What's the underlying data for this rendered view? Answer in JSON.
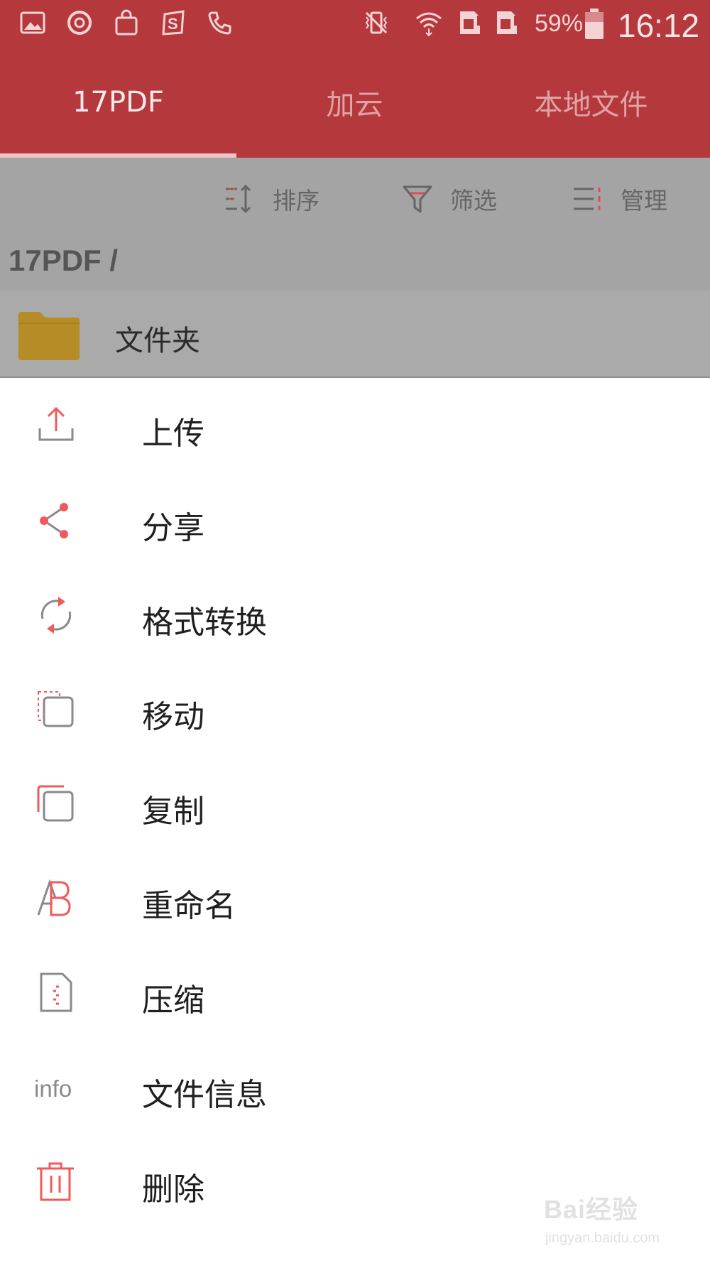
{
  "status_bar": {
    "battery_percent": "59%",
    "time": "16:12",
    "left_icons": [
      "gallery-icon",
      "sync-icon",
      "shopping-bag-icon",
      "s-app-icon",
      "phone-call-icon"
    ],
    "right_icons": [
      "vibrate-icon",
      "wifi-icon",
      "sim1-icon",
      "sim2-icon",
      "battery-icon"
    ]
  },
  "tabs": [
    {
      "label": "17PDF",
      "active": true
    },
    {
      "label": "加云",
      "active": false
    },
    {
      "label": "本地文件",
      "active": false
    }
  ],
  "toolbar": {
    "sort_label": "排序",
    "filter_label": "筛选",
    "manage_label": "管理"
  },
  "breadcrumb": "17PDF /",
  "folder": {
    "name": "文件夹"
  },
  "menu": {
    "items": [
      {
        "label": "上传",
        "icon": "upload-icon"
      },
      {
        "label": "分享",
        "icon": "share-icon"
      },
      {
        "label": "格式转换",
        "icon": "convert-icon"
      },
      {
        "label": "移动",
        "icon": "move-icon"
      },
      {
        "label": "复制",
        "icon": "copy-icon"
      },
      {
        "label": "重命名",
        "icon": "rename-icon"
      },
      {
        "label": "压缩",
        "icon": "compress-icon"
      },
      {
        "label": "文件信息",
        "icon": "info-icon",
        "glyph": "info"
      },
      {
        "label": "删除",
        "icon": "trash-icon"
      }
    ]
  },
  "watermark": {
    "main": "Bai经验",
    "sub": "jingyan.baidu.com"
  },
  "colors": {
    "brand_red": "#b5393c",
    "accent_icon_red": "#f05a5b",
    "folder_gold": "#b58c25"
  }
}
